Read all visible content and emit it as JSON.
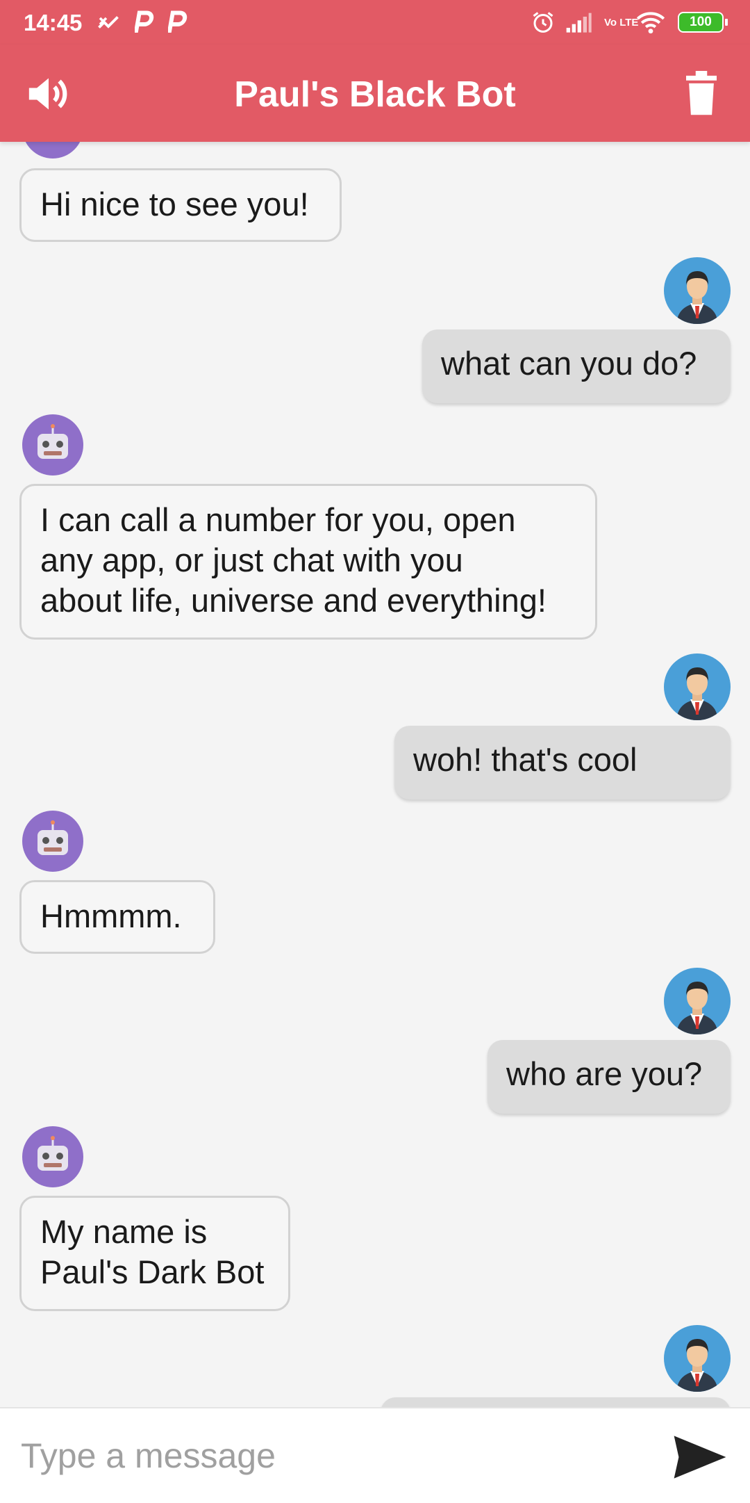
{
  "status_bar": {
    "time": "14:45",
    "network_label": "Vo LTE",
    "battery": "100"
  },
  "app_bar": {
    "title": "Paul's Black Bot",
    "speaker_icon": "speaker-icon",
    "delete_icon": "trash-icon"
  },
  "messages": [
    {
      "sender": "bot",
      "text": "Hi nice to see you!"
    },
    {
      "sender": "user",
      "text": "what can you do?"
    },
    {
      "sender": "bot",
      "lines": [
        "I can call a number for you, open",
        "any app, or just chat with you",
        "about life, universe and everything!"
      ]
    },
    {
      "sender": "user",
      "text": "woh! that's cool"
    },
    {
      "sender": "bot",
      "text": "Hmmmm."
    },
    {
      "sender": "user",
      "text": "who are you?"
    },
    {
      "sender": "bot",
      "lines": [
        "My name is",
        "Paul's Dark Bot"
      ]
    }
  ],
  "composer": {
    "placeholder": "Type a message",
    "send_icon": "send-icon"
  },
  "colors": {
    "accent": "#e25a65",
    "bot_avatar": "#8f6fc9",
    "user_avatar": "#4a9fd8",
    "battery_green": "#3dbb2a"
  }
}
